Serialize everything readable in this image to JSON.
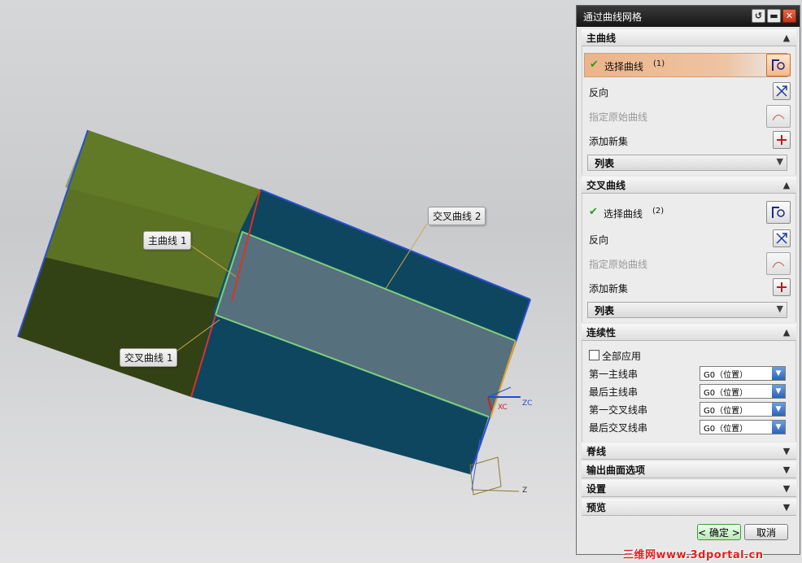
{
  "dialog": {
    "title": "通过曲线网格",
    "sections": {
      "main_curve": {
        "header": "主曲线",
        "select_label": "选择曲线",
        "select_count": "(1)",
        "reverse_label": "反向",
        "specify_origin_label": "指定原始曲线",
        "add_new_set_label": "添加新集",
        "list_label": "列表"
      },
      "cross_curve": {
        "header": "交叉曲线",
        "select_label": "选择曲线",
        "select_count": "(2)",
        "reverse_label": "反向",
        "specify_origin_label": "指定原始曲线",
        "add_new_set_label": "添加新集",
        "list_label": "列表"
      },
      "continuity": {
        "header": "连续性",
        "apply_all_label": "全部应用",
        "rows": [
          {
            "label": "第一主线串",
            "value": "G0（位置）"
          },
          {
            "label": "最后主线串",
            "value": "G0（位置）"
          },
          {
            "label": "第一交叉线串",
            "value": "G0（位置）"
          },
          {
            "label": "最后交叉线串",
            "value": "G0（位置）"
          }
        ]
      },
      "collapsed": [
        "脊线",
        "输出曲面选项",
        "设置",
        "预览"
      ]
    },
    "buttons": {
      "ok": "< 确定 >",
      "cancel": "取消"
    }
  },
  "viewport": {
    "callouts": {
      "main_curve_1": "主曲线 1",
      "cross_curve_1": "交叉曲线 1",
      "cross_curve_2": "交叉曲线 2"
    },
    "axes": {
      "xc": "XC",
      "zc": "ZC",
      "z": "Z"
    }
  },
  "watermark": "三维网www.3dportal.cn",
  "colors": {
    "green_face": "#5b7224",
    "dark_green_face": "#334214",
    "teal_face": "#0e4660",
    "grey_surface": "#56707e",
    "edge_red": "#e0321e",
    "edge_blue": "#2a4fd0",
    "selection_orange": "#ecb48a"
  }
}
